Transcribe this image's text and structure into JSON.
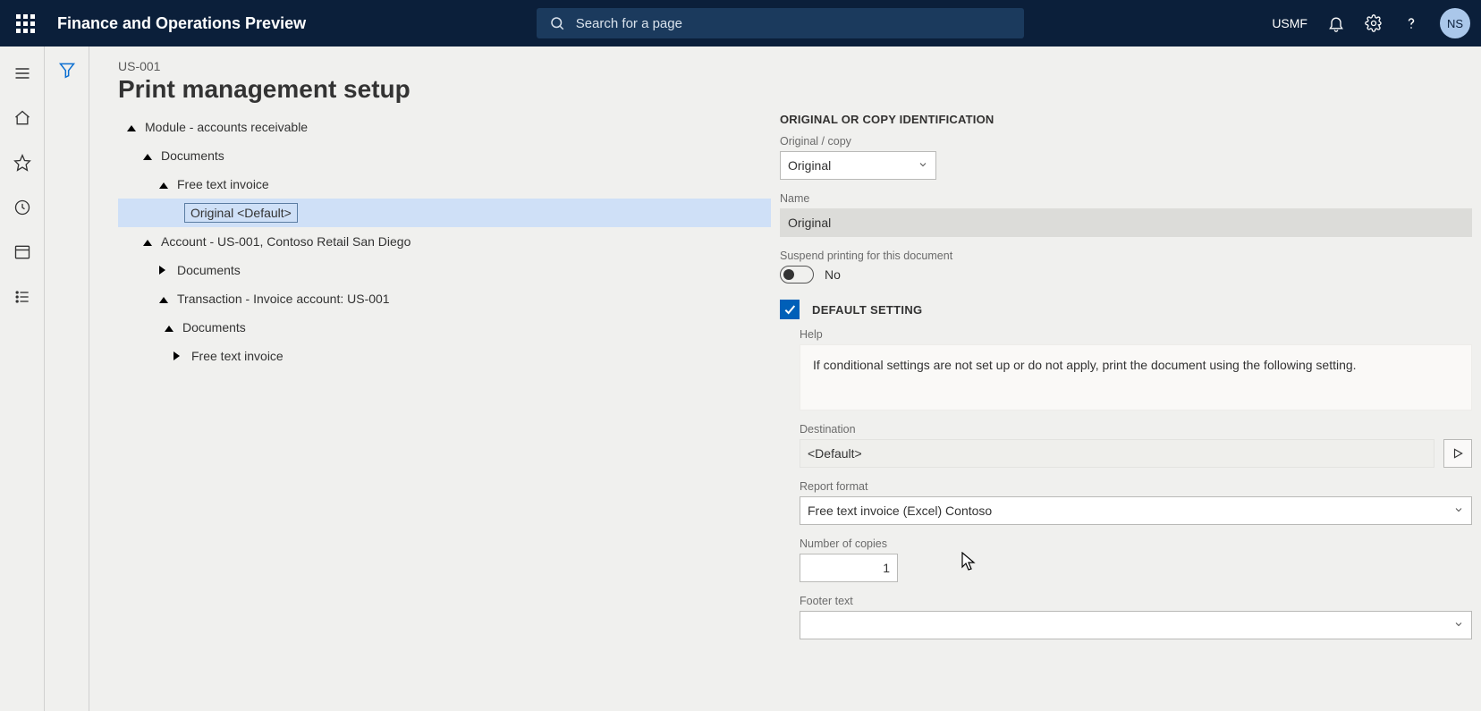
{
  "topbar": {
    "app_title": "Finance and Operations Preview",
    "search_placeholder": "Search for a page",
    "company": "USMF",
    "avatar_initials": "NS"
  },
  "page": {
    "breadcrumb": "US-001",
    "title": "Print management setup"
  },
  "tree": {
    "root": "Module - accounts receivable",
    "documents": "Documents",
    "free_text_invoice": "Free text invoice",
    "original_default": "Original <Default>",
    "account": "Account - US-001, Contoso Retail San Diego",
    "account_documents": "Documents",
    "transaction": "Transaction - Invoice account: US-001",
    "transaction_documents": "Documents",
    "transaction_free_text": "Free text invoice"
  },
  "form": {
    "section_identification": "ORIGINAL OR COPY IDENTIFICATION",
    "original_copy_label": "Original / copy",
    "original_copy_value": "Original",
    "name_label": "Name",
    "name_value": "Original",
    "suspend_label": "Suspend printing for this document",
    "suspend_value": "No",
    "default_setting_label": "DEFAULT SETTING",
    "help_label": "Help",
    "help_text": "If conditional settings are not set up or do not apply, print the document using the following setting.",
    "destination_label": "Destination",
    "destination_value": "<Default>",
    "report_format_label": "Report format",
    "report_format_value": "Free text invoice (Excel) Contoso",
    "num_copies_label": "Number of copies",
    "num_copies_value": "1",
    "footer_label": "Footer text",
    "footer_value": ""
  }
}
